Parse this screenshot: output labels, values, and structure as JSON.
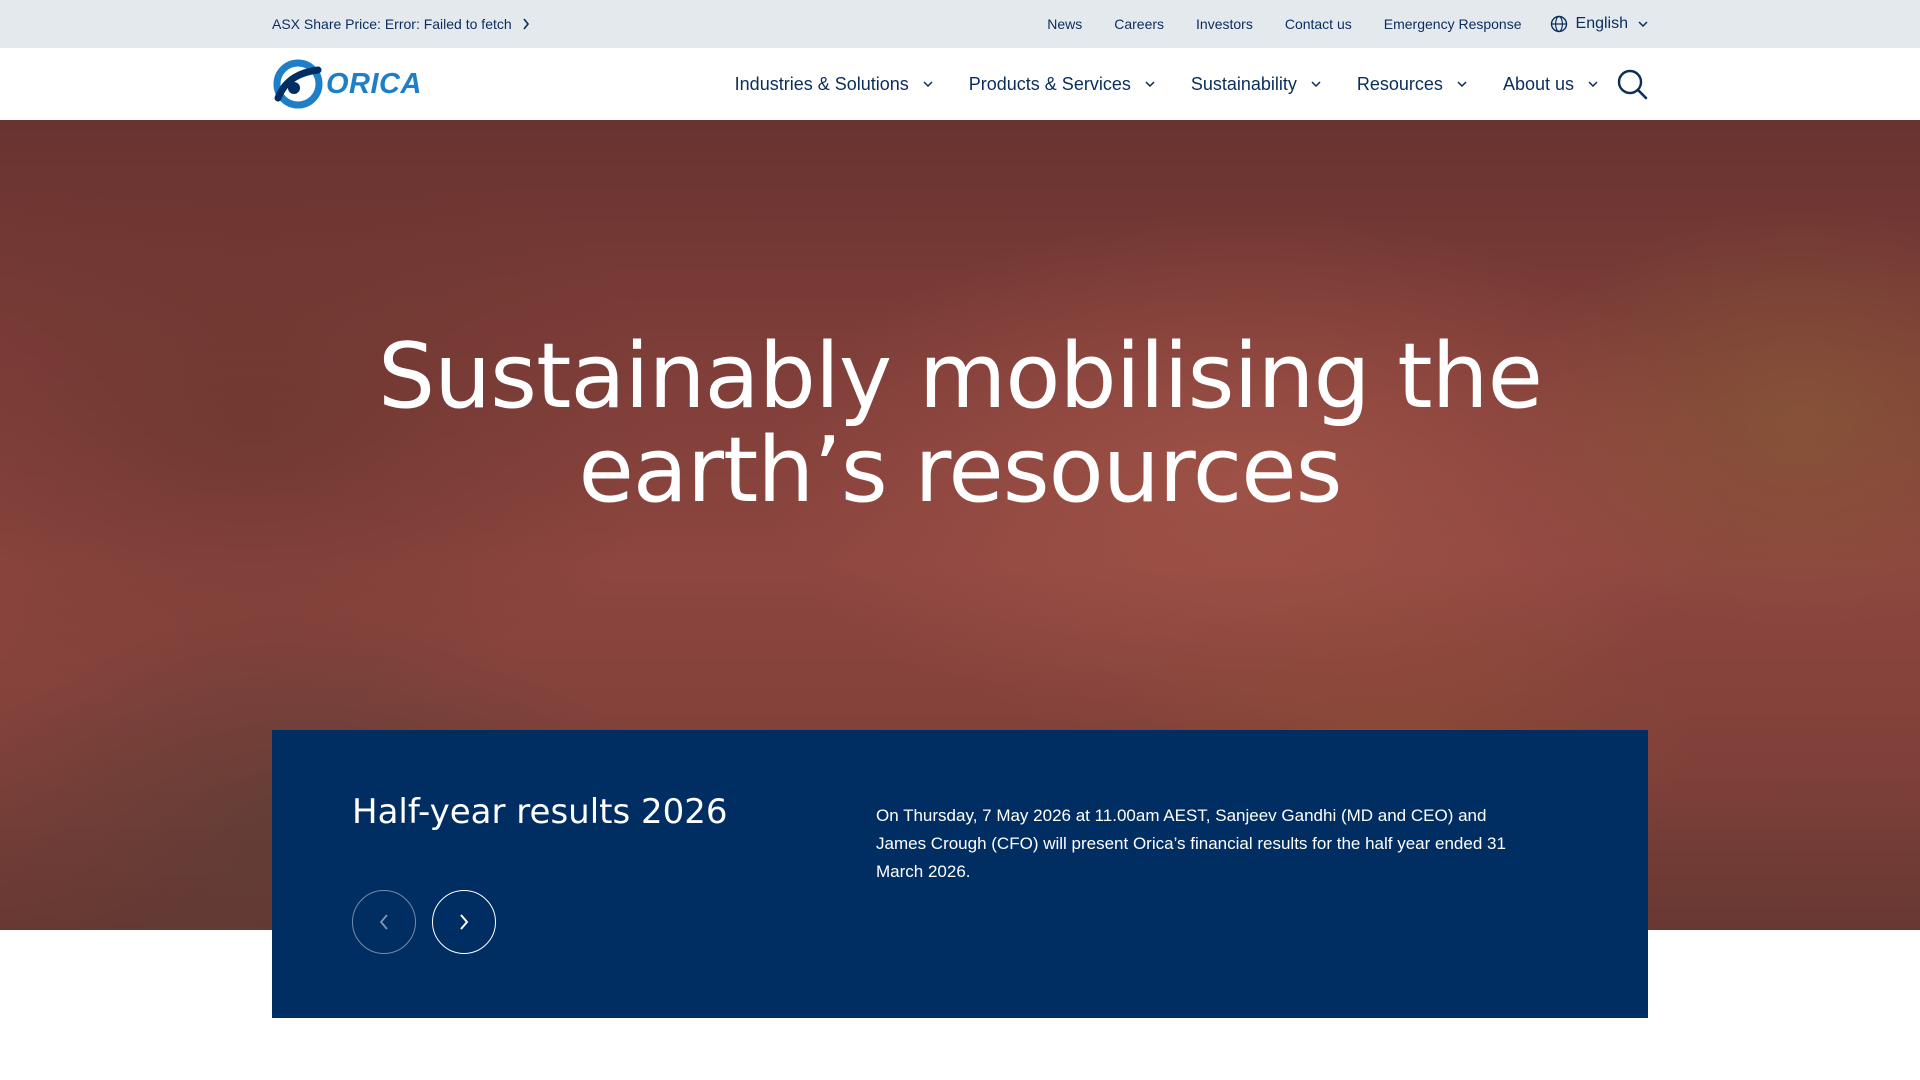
{
  "utility_bar": {
    "share_price": "ASX Share Price: Error: Failed to fetch",
    "links": [
      "News",
      "Careers",
      "Investors",
      "Contact us",
      "Emergency Response"
    ],
    "language": "English"
  },
  "header": {
    "logo_text": "ORICA",
    "nav": [
      {
        "label": "Industries & Solutions"
      },
      {
        "label": "Products & Services"
      },
      {
        "label": "Sustainability"
      },
      {
        "label": "Resources"
      },
      {
        "label": "About us"
      }
    ],
    "search_icon": "search-icon"
  },
  "hero": {
    "title_line1": "Sustainably mobilising the",
    "title_line2": "earth’s resources"
  },
  "feature": {
    "title": "Half-year results 2026",
    "description": "On Thursday, 7 May 2026 at 11.00am AEST, Sanjeev Gandhi (MD and CEO) and James Crough (CFO) will present Orica’s financial results for the half year ended 31 March 2026.",
    "prev_icon": "chevron-left-icon",
    "next_icon": "chevron-right-icon"
  },
  "colors": {
    "navy": "#002d62",
    "text": "#0a2d5c",
    "utility_bg": "#e4e9ee",
    "logo_blue": "#1e7fc9"
  }
}
